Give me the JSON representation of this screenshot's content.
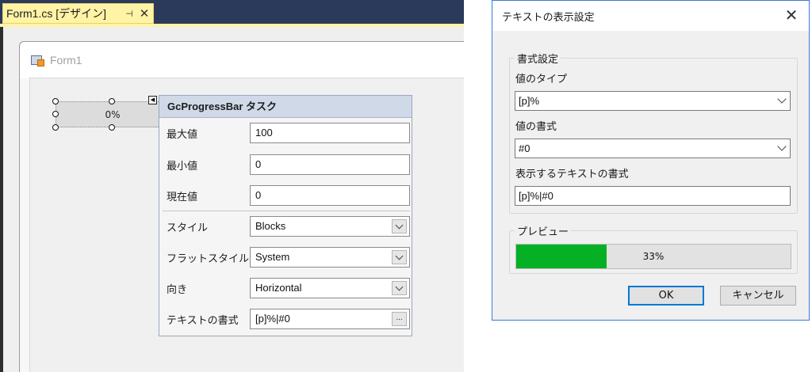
{
  "designer": {
    "tab_title": "Form1.cs [デザイン]",
    "tab_pin": "⊣",
    "tab_close": "✕",
    "form_title": "Form1",
    "progress_label": "0%",
    "tasks": {
      "title": "GcProgressBar タスク",
      "max_label": "最大値",
      "max_value": "100",
      "min_label": "最小値",
      "min_value": "0",
      "current_label": "現在値",
      "current_value": "0",
      "style_label": "スタイル",
      "style_value": "Blocks",
      "flat_style_label": "フラットスタイル",
      "flat_style_value": "System",
      "orientation_label": "向き",
      "orientation_value": "Horizontal",
      "text_format_label": "テキストの書式",
      "text_format_value": "[p]%|#0",
      "ellipsis": "..."
    }
  },
  "dialog": {
    "title": "テキストの表示設定",
    "close_glyph": "✕",
    "format_group": "書式設定",
    "value_type_label": "値のタイプ",
    "value_type_value": "[p]%",
    "value_format_label": "値の書式",
    "value_format_value": "#0",
    "display_format_label": "表示するテキストの書式",
    "display_format_value": "[p]%|#0",
    "preview_group": "プレビュー",
    "preview_text": "33%",
    "preview_progress": 0.33,
    "preview_color": "#06b025",
    "ok_label": "OK",
    "cancel_label": "キャンセル"
  }
}
